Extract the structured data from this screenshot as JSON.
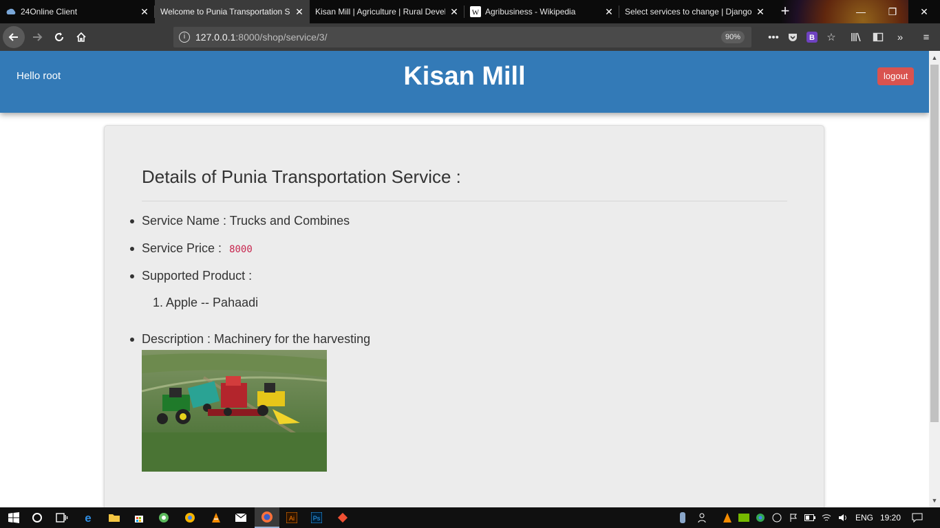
{
  "browser": {
    "tabs": [
      {
        "title": "24Online Client",
        "active": false
      },
      {
        "title": "Welcome to Punia Transportation S",
        "active": true
      },
      {
        "title": "Kisan Mill | Agriculture | Rural Devel",
        "active": false
      },
      {
        "title": "Agribusiness - Wikipedia",
        "active": false
      },
      {
        "title": "Select services to change | Django s",
        "active": false
      }
    ],
    "url_host": "127.0.0.1",
    "url_path": ":8000/shop/service/3/",
    "zoom": "90%"
  },
  "header": {
    "greeting": "Hello root",
    "brand": "Kisan Mill",
    "logout_label": "logout"
  },
  "service": {
    "heading": "Details of Punia Transportation Service :",
    "name_label": "Service Name : Trucks and Combines",
    "price_label": "Service Price :",
    "price_value": "8000",
    "products_label": "Supported Product :",
    "products": [
      "1. Apple -- Pahaadi"
    ],
    "description_label": "Description : Machinery for the harvesting"
  },
  "taskbar": {
    "language": "ENG",
    "time": "19:20"
  },
  "colors": {
    "header_blue": "#337ab7",
    "logout_red": "#d9534f",
    "code_pink": "#c7254e"
  }
}
